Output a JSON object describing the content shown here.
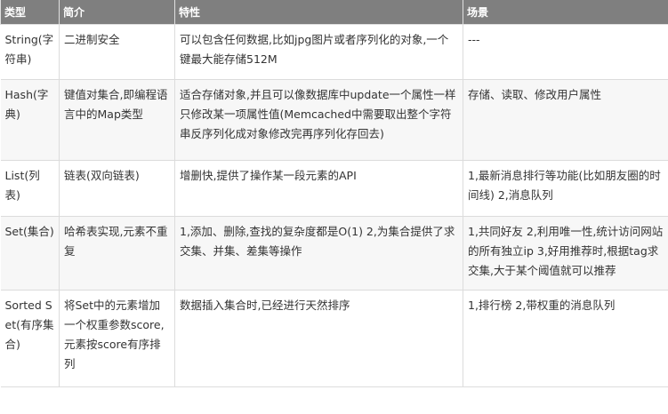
{
  "table": {
    "headers": [
      "类型",
      "简介",
      "特性",
      "场景"
    ],
    "rows": [
      [
        "String(字符串)",
        "二进制安全",
        "可以包含任何数据,比如jpg图片或者序列化的对象,一个键最大能存储512M",
        "---"
      ],
      [
        "Hash(字典)",
        "键值对集合,即编程语言中的Map类型",
        "适合存储对象,并且可以像数据库中update一个属性一样只修改某一项属性值(Memcached中需要取出整个字符串反序列化成对象修改完再序列化存回去)",
        "存储、读取、修改用户属性"
      ],
      [
        "List(列表)",
        "链表(双向链表)",
        "增删快,提供了操作某一段元素的API",
        "1,最新消息排行等功能(比如朋友圈的时间线) 2,消息队列"
      ],
      [
        "Set(集合)",
        "哈希表实现,元素不重复",
        "1,添加、删除,查找的复杂度都是O(1) 2,为集合提供了求交集、并集、差集等操作",
        "1,共同好友 2,利用唯一性,统计访问网站的所有独立ip 3,好用推荐时,根据tag求交集,大于某个阈值就可以推荐"
      ],
      [
        "Sorted Set(有序集合)",
        "将Set中的元素增加一个权重参数score,元素按score有序排列",
        "数据插入集合时,已经进行天然排序",
        "1,排行榜 2,带权重的消息队列"
      ]
    ]
  }
}
